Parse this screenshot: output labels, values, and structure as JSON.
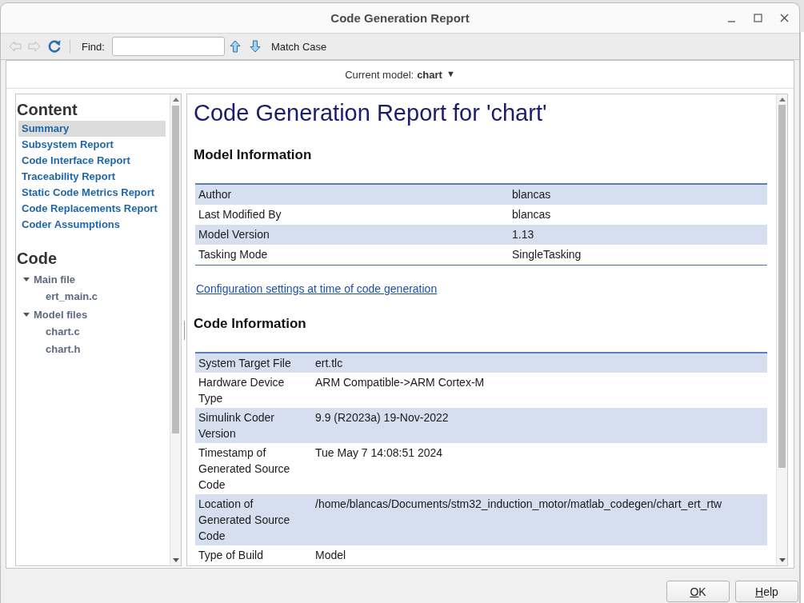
{
  "window": {
    "title": "Code Generation Report"
  },
  "toolbar": {
    "nav_buttons": [
      {
        "kind": "back",
        "disabled": true
      },
      {
        "kind": "forward",
        "disabled": true
      },
      {
        "kind": "refresh",
        "disabled": false
      }
    ],
    "find_label": "Find:",
    "match_case": "Match Case"
  },
  "model_selector": {
    "label": "Current model:",
    "value": "chart",
    "caret": "▼"
  },
  "sidebar": {
    "content": {
      "heading": "Content",
      "items": [
        {
          "label": "Summary",
          "selected": true
        },
        {
          "label": "Subsystem Report",
          "selected": false
        },
        {
          "label": "Code Interface Report",
          "selected": false
        },
        {
          "label": "Traceability Report",
          "selected": false
        },
        {
          "label": "Static Code Metrics Report",
          "selected": false
        },
        {
          "label": "Code Replacements Report",
          "selected": false
        },
        {
          "label": "Coder Assumptions",
          "selected": false
        }
      ]
    },
    "code": {
      "heading": "Code",
      "tree": [
        {
          "label": "Main file",
          "expanded": true,
          "children": [
            {
              "label": "ert_main.c",
              "selected": false
            }
          ]
        },
        {
          "label": "Model files",
          "expanded": true,
          "children": [
            {
              "label": "chart.c",
              "selected": false
            },
            {
              "label": "chart.h",
              "selected": false
            }
          ]
        }
      ]
    }
  },
  "report": {
    "title": "Code Generation Report for 'chart'",
    "sections": [
      {
        "heading": "Model Information",
        "kind": "wide",
        "rows": [
          {
            "label": "Author",
            "value": "blancas"
          },
          {
            "label": "Last Modified By",
            "value": "blancas"
          },
          {
            "label": "Model Version",
            "value": "1.13"
          },
          {
            "label": "Tasking Mode",
            "value": "SingleTasking"
          }
        ],
        "link": "Configuration settings at time of code generation"
      },
      {
        "heading": "Code Information",
        "kind": "narrow",
        "rows": [
          {
            "label": "System Target File",
            "value": "ert.tlc"
          },
          {
            "label": "Hardware Device Type",
            "value": "ARM Compatible->ARM Cortex-M"
          },
          {
            "label": "Simulink Coder Version",
            "value": "9.9 (R2023a) 19-Nov-2022"
          },
          {
            "label": "Timestamp of Generated Source Code",
            "value": "Tue May 7 14:08:51 2024"
          },
          {
            "label": "Location of Generated Source Code",
            "value": "/home/blancas/Documents/stm32_induction_motor/matlab_codegen/chart_ert_rtw"
          },
          {
            "label": "Type of Build",
            "value": "Model"
          }
        ]
      }
    ]
  },
  "buttons": [
    {
      "label": "OK"
    },
    {
      "label": "Help"
    }
  ]
}
